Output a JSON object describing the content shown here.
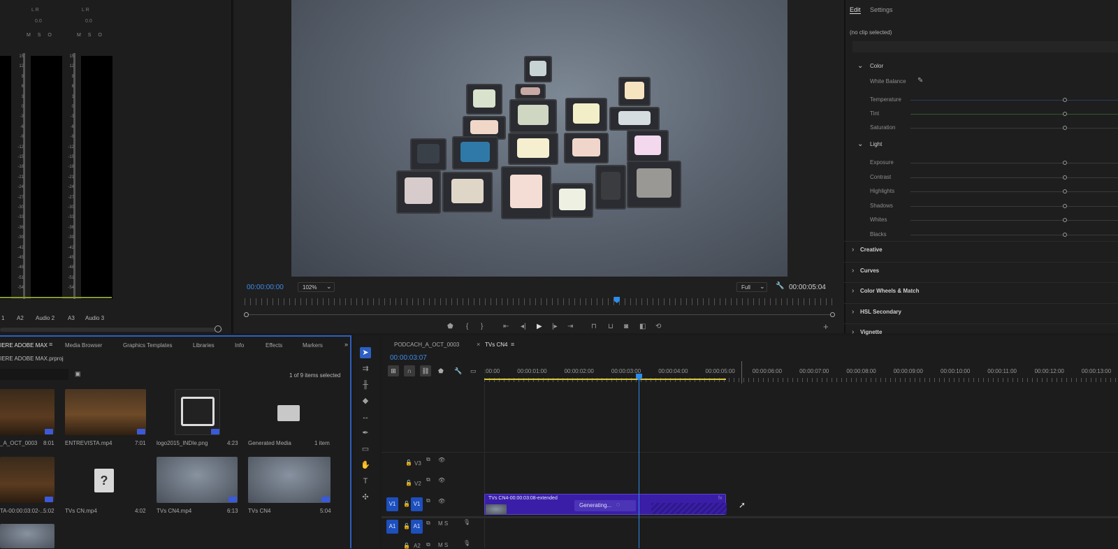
{
  "mixer": {
    "top_meter_label": "L R",
    "top_values": [
      "0.0",
      "0.0"
    ],
    "ms_labels": [
      "M S O",
      "M S O"
    ],
    "scale": [
      "15",
      "12",
      "9",
      "6",
      "3",
      "0",
      "-3",
      "-6",
      "-9",
      "-12",
      "-15",
      "-18",
      "-21",
      "-24",
      "-27",
      "-30",
      "-33",
      "-36",
      "-39",
      "-42",
      "-45",
      "-48",
      "-51",
      "-54"
    ],
    "channels": [
      {
        "id": "1",
        "name": ""
      },
      {
        "id": "A2",
        "name": "Audio 2"
      },
      {
        "id": "A3",
        "name": "Audio 3"
      }
    ]
  },
  "monitor": {
    "timecode_current": "00:00:00:00",
    "zoom": "102%",
    "quality": "Full",
    "timecode_duration": "00:00:05:04",
    "playhead_fraction": 0.63
  },
  "lumetri": {
    "tabs": [
      "Edit",
      "Settings"
    ],
    "clip_status": "(no clip selected)",
    "color_section": "Color",
    "white_balance": "White Balance",
    "color_sliders": [
      "Temperature",
      "Tint",
      "Saturation"
    ],
    "light_section": "Light",
    "light_sliders": [
      "Exposure",
      "Contrast",
      "Highlights",
      "Shadows",
      "Whites",
      "Blacks"
    ],
    "collapsed_sections": [
      "Creative",
      "Curves",
      "Color Wheels & Match",
      "HSL Secondary",
      "Vignette"
    ]
  },
  "project": {
    "tabs": [
      "IERE ADOBE MAX",
      "Media Browser",
      "Graphics Templates",
      "Libraries",
      "Info",
      "Effects",
      "Markers"
    ],
    "file": "IERE ADOBE MAX.prproj",
    "selection": "1 of 9 items selected",
    "items": [
      {
        "name": "_A_OCT_0003",
        "duration": "8:01"
      },
      {
        "name": "ENTREVISTA.mp4",
        "duration": "7:01"
      },
      {
        "name": "logo2015_INDIe.png",
        "duration": "4:23"
      },
      {
        "name": "Generated Media",
        "duration": "1 item"
      },
      {
        "name": "TA-00:00:03:02-...",
        "duration": "5:02"
      },
      {
        "name": "TVs CN.mp4",
        "duration": "4:02"
      },
      {
        "name": "TVs CN4.mp4",
        "duration": "6:13"
      },
      {
        "name": "TVs CN4",
        "duration": "5:04"
      }
    ]
  },
  "timeline": {
    "tabs": [
      "PODCACH_A_OCT_0003",
      "TVs CN4"
    ],
    "timecode": "00:00:03:07",
    "ruler": [
      ":00:00",
      "00:00:01:00",
      "00:00:02:00",
      "00:00:03:00",
      "00:00:04:00",
      "00:00:05:00",
      "00:00:06:00",
      "00:00:07:00",
      "00:00:08:00",
      "00:00:09:00",
      "00:00:10:00",
      "00:00:11:00",
      "00:00:12:00",
      "00:00:13:00"
    ],
    "tracks": {
      "v3": "V3",
      "v2": "V2",
      "v1": "V1",
      "a1": "A1",
      "a2": "A2"
    },
    "track_ms": "M S",
    "clip_name": "TVs CN4-00:00:03:08-extended",
    "generating": "Generating...",
    "clip_fx": "fx"
  },
  "colors": {
    "accent": "#2d8ceb",
    "clip": "#3a1ea8",
    "workarea": "#d9c93a"
  }
}
